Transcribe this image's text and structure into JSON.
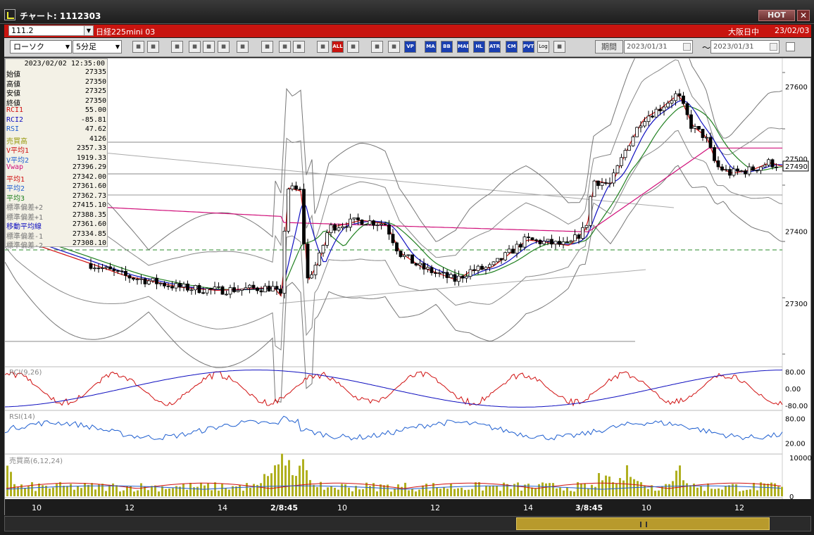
{
  "window": {
    "title": "チャート: 1112303",
    "hot_label": "HOT",
    "close_label": "✕"
  },
  "symbol_bar": {
    "code": "111.2",
    "product": "日経225mini 03",
    "session": "大阪日中",
    "date": "23/02/03"
  },
  "toolbar": {
    "chart_type": "ローソク",
    "interval": "5分足",
    "buttons": [
      "zoom-icon",
      "bar-icon",
      "pin-icon",
      "range-icon",
      "grid-icon",
      "text-icon",
      "line-icon",
      "cursor-icon",
      "undo-icon",
      "candle-icon",
      "bar2-icon",
      "ALL",
      "settings-icon",
      "ruler-icon",
      "palette-icon",
      "VP",
      "MA",
      "BB",
      "MAE",
      "HL",
      "ATR",
      "CM",
      "PVT",
      "Log",
      "export-icon"
    ],
    "period_label": "期間",
    "date_from": "2023/01/31",
    "date_to": "2023/01/31",
    "tilde": "〜"
  },
  "info_panel": {
    "datetime": "2023/02/02  12:35:00",
    "rows": [
      {
        "label": "始値",
        "value": "27335",
        "color": "#000000"
      },
      {
        "label": "高値",
        "value": "27350",
        "color": "#000000"
      },
      {
        "label": "安値",
        "value": "27325",
        "color": "#000000"
      },
      {
        "label": "終値",
        "value": "27350",
        "color": "#000000"
      },
      {
        "label": "RCI1",
        "value": "55.00",
        "color": "#d01010"
      },
      {
        "label": "RCI2",
        "value": "-85.81",
        "color": "#1010c0"
      },
      {
        "label": "RSI",
        "value": "47.62",
        "color": "#1f5fd0"
      },
      {
        "label": "売買高",
        "value": "4126",
        "color": "#9a9a10"
      },
      {
        "label": "V平均1",
        "value": "2357.33",
        "color": "#d01010"
      },
      {
        "label": "V平均2",
        "value": "1919.33",
        "color": "#1f5fd0"
      },
      {
        "label": "Vwap",
        "value": "27396.29",
        "color": "#d0107a"
      },
      {
        "label": "平均1",
        "value": "27342.00",
        "color": "#d01010"
      },
      {
        "label": "平均2",
        "value": "27361.60",
        "color": "#1f5fd0"
      },
      {
        "label": "平均3",
        "value": "27362.73",
        "color": "#208020"
      },
      {
        "label": "標準偏差+2",
        "value": "27415.10",
        "color": "#777777"
      },
      {
        "label": "標準偏差+1",
        "value": "27388.35",
        "color": "#777777"
      },
      {
        "label": "移動平均線",
        "value": "27361.60",
        "color": "#1010c0"
      },
      {
        "label": "標準偏差-1",
        "value": "27334.85",
        "color": "#777777"
      },
      {
        "label": "標準偏差-2",
        "value": "27308.10",
        "color": "#777777"
      }
    ]
  },
  "price_axis": {
    "ticks": [
      "27600",
      "27500",
      "27400",
      "27300"
    ],
    "current_price": "27490"
  },
  "time_axis": {
    "ticks": [
      "10",
      "12",
      "14",
      "2/8:45",
      "10",
      "12",
      "14",
      "3/8:45",
      "10",
      "12"
    ]
  },
  "panels": {
    "rci": {
      "title": "RCI(9,26)",
      "ticks": [
        "80.00",
        "0.00",
        "-80.00"
      ]
    },
    "rsi": {
      "title": "RSI(14)",
      "ticks": [
        "80.00",
        "20.00"
      ]
    },
    "volume": {
      "title": "売買高(6,12,24)",
      "ticks": [
        "10000",
        "0"
      ]
    }
  },
  "colors": {
    "window_bg": "#1c1c1c",
    "symbol_bar": "#c8140f",
    "ma_short": "#d01010",
    "ma_mid": "#1010c0",
    "ma_long": "#208020",
    "vwap": "#d0107a",
    "volume_bar": "#b0b020"
  }
}
